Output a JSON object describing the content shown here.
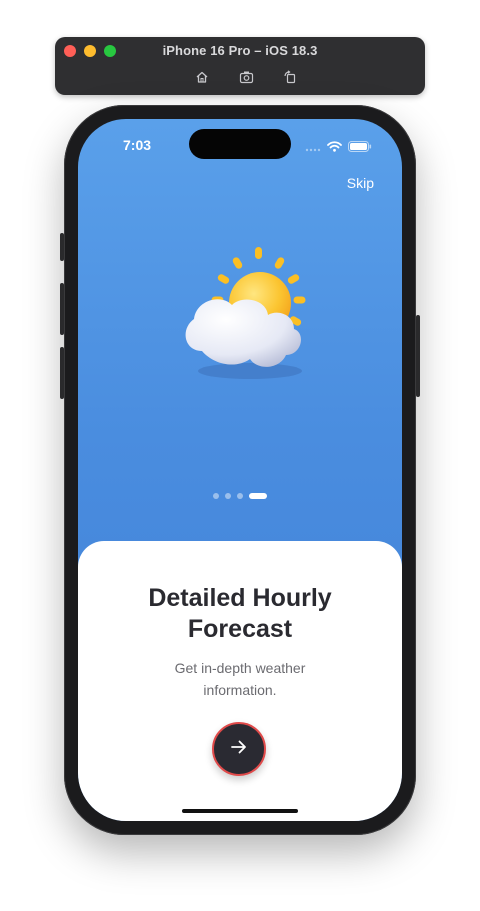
{
  "simulator": {
    "title": "iPhone 16 Pro – iOS 18.3",
    "tools": [
      "home-icon",
      "screenshot-icon",
      "rotate-icon"
    ]
  },
  "status_bar": {
    "time": "7:03",
    "icons": [
      "cellular-icon",
      "wifi-icon",
      "battery-icon"
    ]
  },
  "onboarding": {
    "skip_label": "Skip",
    "illustration": "partly-cloudy-icon",
    "page_count": 4,
    "current_page": 4,
    "title": "Detailed Hourly Forecast",
    "subtitle": "Get in-depth weather information.",
    "next_button_icon": "arrow-right-icon"
  },
  "colors": {
    "gradient_top": "#5aa0ea",
    "gradient_bottom": "#3f7fd6",
    "sheet": "#ffffff",
    "button": "#2a2a32",
    "button_border": "#e04a4a",
    "sun": "#fbbf24"
  }
}
